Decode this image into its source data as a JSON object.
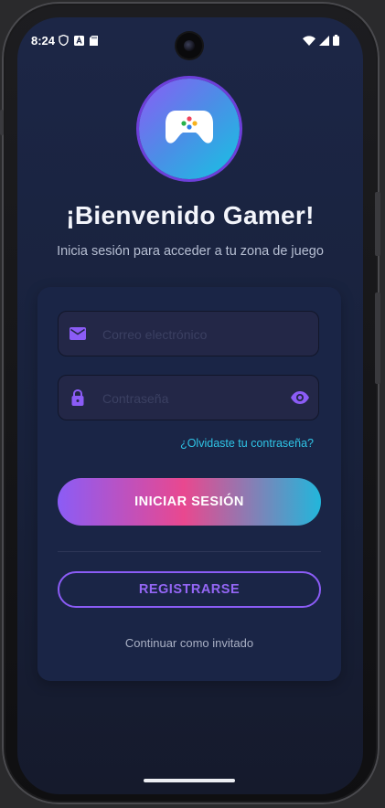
{
  "status_bar": {
    "time": "8:24",
    "left_icons": [
      "shield-icon",
      "a-badge-icon",
      "sd-card-icon"
    ],
    "right_icons": [
      "wifi-icon",
      "signal-icon",
      "battery-icon"
    ]
  },
  "header": {
    "logo_icon": "gamepad-icon",
    "title": "¡Bienvenido Gamer!",
    "subtitle": "Inicia sesión para acceder a tu zona de juego"
  },
  "form": {
    "email": {
      "placeholder": "Correo electrónico",
      "value": "",
      "icon": "mail-icon"
    },
    "password": {
      "placeholder": "Contraseña",
      "value": "",
      "icon": "lock-icon",
      "toggle_icon": "eye-icon"
    },
    "forgot_password": "¿Olvidaste tu contraseña?",
    "login_button": "INICIAR SESIÓN",
    "register_button": "REGISTRARSE",
    "guest_link": "Continuar como invitado"
  },
  "colors": {
    "accent_purple": "#8b5cf6",
    "accent_pink": "#e9488f",
    "accent_cyan": "#22b6db",
    "link_cyan": "#2fc4e6",
    "background": "#1c2646",
    "card": "#1a2546"
  }
}
